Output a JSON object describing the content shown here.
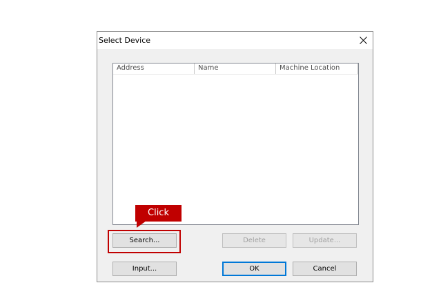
{
  "dialog": {
    "title": "Select Device",
    "close_glyph": "close-icon"
  },
  "list": {
    "columns": [
      "Address",
      "Name",
      "Machine Location"
    ],
    "rows": []
  },
  "buttons": {
    "search": "Search...",
    "delete": "Delete",
    "update": "Update...",
    "input": "Input...",
    "ok": "OK",
    "cancel": "Cancel"
  },
  "annotation": {
    "callout_text": "Click",
    "color": "#c00000"
  }
}
